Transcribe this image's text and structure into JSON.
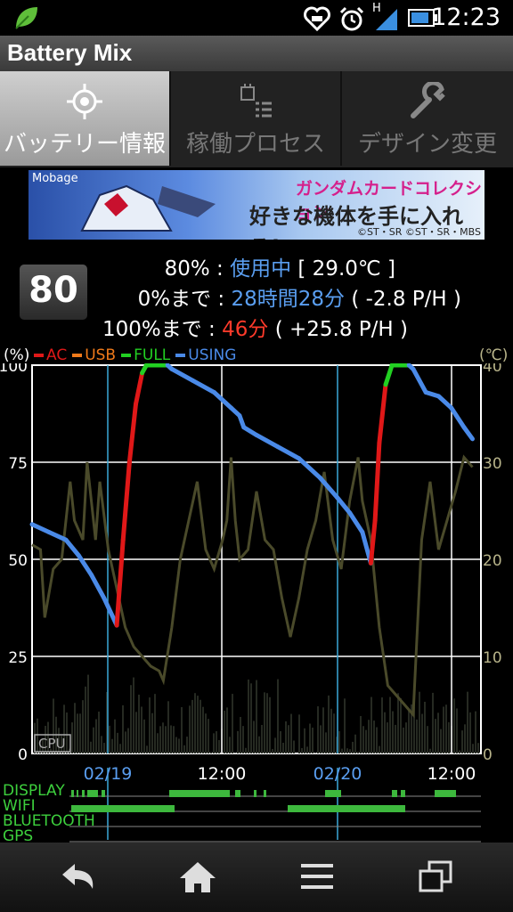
{
  "status_bar": {
    "time": "12:23",
    "network": "H",
    "icons": [
      "leaf-icon",
      "heart-icon",
      "alarm-icon",
      "signal-icon",
      "battery-icon"
    ]
  },
  "app": {
    "title": "Battery Mix"
  },
  "tabs": [
    {
      "label": "バッテリー情報",
      "icon": "target-icon",
      "active": true
    },
    {
      "label": "稼働プロセス",
      "icon": "process-list-icon",
      "active": false
    },
    {
      "label": "デザイン変更",
      "icon": "wrench-icon",
      "active": false
    }
  ],
  "banner": {
    "brand": "Mobage",
    "line1": "ガンダムカードコレクション",
    "line2": "好きな機体を手に入れろ!",
    "credit": "©ST・SR ©ST・SR・MBS"
  },
  "battery": {
    "level": "80",
    "row1": {
      "label": "80% : ",
      "status": "使用中",
      "temp": " [ 29.0℃ ]"
    },
    "row2": {
      "label": "0%まで : ",
      "time": "28時間28分",
      "rate": " ( -2.8 P/H )"
    },
    "row3": {
      "label": "100%まで : ",
      "time": "46分",
      "rate": " ( +25.8 P/H )"
    }
  },
  "legend": {
    "left_unit": "(%)",
    "right_unit": "(℃)",
    "items": [
      {
        "label": "AC",
        "color": "#e01818"
      },
      {
        "label": "USB",
        "color": "#f07a1a"
      },
      {
        "label": "FULL",
        "color": "#22d022"
      },
      {
        "label": "USING",
        "color": "#4a8ae8"
      }
    ]
  },
  "chart_data": {
    "type": "line",
    "y_left": {
      "ticks": [
        "100",
        "75",
        "50",
        "25",
        "0"
      ],
      "range": [
        0,
        100
      ]
    },
    "y_right": {
      "ticks": [
        "40",
        "30",
        "20",
        "10",
        "0"
      ],
      "range": [
        0,
        40
      ]
    },
    "x_ticks": [
      {
        "label": "02/19",
        "color": "#5a9ef0"
      },
      {
        "label": "12:00",
        "color": "#ffffff"
      },
      {
        "label": "02/20",
        "color": "#5a9ef0"
      },
      {
        "label": "12:00",
        "color": "#ffffff"
      }
    ],
    "cpu_label": "CPU",
    "series_battery": [
      {
        "t": 0,
        "v": 59,
        "mode": "USING"
      },
      {
        "t": 4,
        "v": 57,
        "mode": "USING"
      },
      {
        "t": 8,
        "v": 55,
        "mode": "USING"
      },
      {
        "t": 11,
        "v": 51,
        "mode": "USING"
      },
      {
        "t": 14,
        "v": 46,
        "mode": "USING"
      },
      {
        "t": 17,
        "v": 40,
        "mode": "USING"
      },
      {
        "t": 20,
        "v": 33,
        "mode": "USING"
      },
      {
        "t": 21.5,
        "v": 55,
        "mode": "AC"
      },
      {
        "t": 23,
        "v": 75,
        "mode": "AC"
      },
      {
        "t": 24.5,
        "v": 90,
        "mode": "AC"
      },
      {
        "t": 26,
        "v": 98,
        "mode": "AC"
      },
      {
        "t": 27,
        "v": 100,
        "mode": "FULL"
      },
      {
        "t": 32,
        "v": 100,
        "mode": "FULL"
      },
      {
        "t": 33,
        "v": 99,
        "mode": "USING"
      },
      {
        "t": 38,
        "v": 96,
        "mode": "USING"
      },
      {
        "t": 43,
        "v": 93,
        "mode": "USING"
      },
      {
        "t": 47,
        "v": 89,
        "mode": "USING"
      },
      {
        "t": 49,
        "v": 87,
        "mode": "USING"
      },
      {
        "t": 50,
        "v": 84,
        "mode": "USING"
      },
      {
        "t": 53,
        "v": 82,
        "mode": "USING"
      },
      {
        "t": 58,
        "v": 79,
        "mode": "USING"
      },
      {
        "t": 63,
        "v": 76,
        "mode": "USING"
      },
      {
        "t": 68,
        "v": 71,
        "mode": "USING"
      },
      {
        "t": 72,
        "v": 66,
        "mode": "USING"
      },
      {
        "t": 75,
        "v": 62,
        "mode": "USING"
      },
      {
        "t": 78,
        "v": 57,
        "mode": "USING"
      },
      {
        "t": 80,
        "v": 49,
        "mode": "USING"
      },
      {
        "t": 81,
        "v": 60,
        "mode": "AC"
      },
      {
        "t": 82,
        "v": 80,
        "mode": "AC"
      },
      {
        "t": 83.5,
        "v": 95,
        "mode": "AC"
      },
      {
        "t": 85,
        "v": 100,
        "mode": "FULL"
      },
      {
        "t": 89,
        "v": 100,
        "mode": "FULL"
      },
      {
        "t": 90,
        "v": 99,
        "mode": "USING"
      },
      {
        "t": 93,
        "v": 93,
        "mode": "USING"
      },
      {
        "t": 96,
        "v": 92,
        "mode": "USING"
      },
      {
        "t": 99,
        "v": 89,
        "mode": "USING"
      },
      {
        "t": 102,
        "v": 84,
        "mode": "USING"
      },
      {
        "t": 104,
        "v": 81,
        "mode": "USING"
      }
    ],
    "series_temperature": [
      {
        "t": 0,
        "v": 21.5
      },
      {
        "t": 2,
        "v": 21
      },
      {
        "t": 3,
        "v": 14
      },
      {
        "t": 5,
        "v": 19
      },
      {
        "t": 7,
        "v": 20
      },
      {
        "t": 9,
        "v": 28
      },
      {
        "t": 10,
        "v": 24
      },
      {
        "t": 12,
        "v": 22
      },
      {
        "t": 13,
        "v": 30
      },
      {
        "t": 15,
        "v": 22
      },
      {
        "t": 16,
        "v": 28
      },
      {
        "t": 18,
        "v": 21
      },
      {
        "t": 20,
        "v": 17
      },
      {
        "t": 22,
        "v": 13
      },
      {
        "t": 24,
        "v": 11
      },
      {
        "t": 26,
        "v": 10
      },
      {
        "t": 28,
        "v": 9
      },
      {
        "t": 30,
        "v": 8.5
      },
      {
        "t": 31,
        "v": 7.5
      },
      {
        "t": 33,
        "v": 13
      },
      {
        "t": 35,
        "v": 20
      },
      {
        "t": 37,
        "v": 24
      },
      {
        "t": 39,
        "v": 28
      },
      {
        "t": 41,
        "v": 21
      },
      {
        "t": 43,
        "v": 19
      },
      {
        "t": 45,
        "v": 22
      },
      {
        "t": 46,
        "v": 24
      },
      {
        "t": 47,
        "v": 30.5
      },
      {
        "t": 48,
        "v": 24
      },
      {
        "t": 49,
        "v": 20
      },
      {
        "t": 51,
        "v": 21
      },
      {
        "t": 53,
        "v": 27
      },
      {
        "t": 55,
        "v": 22
      },
      {
        "t": 57,
        "v": 21
      },
      {
        "t": 59,
        "v": 16
      },
      {
        "t": 61,
        "v": 12
      },
      {
        "t": 63,
        "v": 16
      },
      {
        "t": 65,
        "v": 21
      },
      {
        "t": 67,
        "v": 24
      },
      {
        "t": 69,
        "v": 29
      },
      {
        "t": 71,
        "v": 22
      },
      {
        "t": 73,
        "v": 19
      },
      {
        "t": 75,
        "v": 26
      },
      {
        "t": 77,
        "v": 30.5
      },
      {
        "t": 78,
        "v": 26
      },
      {
        "t": 80,
        "v": 22
      },
      {
        "t": 82,
        "v": 13
      },
      {
        "t": 84,
        "v": 7
      },
      {
        "t": 86,
        "v": 6
      },
      {
        "t": 88,
        "v": 5
      },
      {
        "t": 90,
        "v": 4
      },
      {
        "t": 92,
        "v": 22
      },
      {
        "t": 94,
        "v": 28
      },
      {
        "t": 96,
        "v": 21
      },
      {
        "t": 98,
        "v": 24
      },
      {
        "t": 100,
        "v": 27
      },
      {
        "t": 102,
        "v": 30.5
      },
      {
        "t": 104,
        "v": 29.5
      }
    ]
  },
  "activity": {
    "rows": [
      {
        "label": "DISPLAY"
      },
      {
        "label": "WIFI"
      },
      {
        "label": "BLUETOOTH"
      },
      {
        "label": "GPS"
      }
    ]
  },
  "nav": {
    "buttons": [
      "back-icon",
      "home-icon",
      "menu-icon",
      "recent-apps-icon"
    ]
  }
}
